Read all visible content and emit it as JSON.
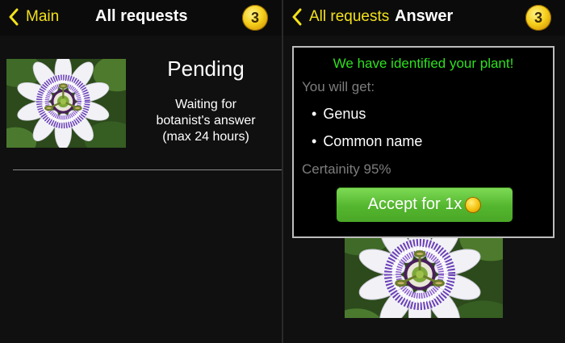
{
  "left_screen": {
    "nav": {
      "back_label": "Main",
      "title": "All requests",
      "coin_count": "3"
    },
    "request": {
      "status": "Pending",
      "description_lines": [
        "Waiting for",
        "botanist's answer",
        "(max 24 hours)"
      ]
    }
  },
  "right_screen": {
    "nav": {
      "back_label": "All requests",
      "title": "Answer",
      "coin_count": "3"
    },
    "card": {
      "headline": "We have identified your plant!",
      "you_will_get": "You will get:",
      "items": [
        "Genus",
        "Common name"
      ],
      "certainty": "Certainity 95%",
      "accept_label": "Accept for 1x"
    }
  },
  "colors": {
    "accent_yellow": "#f3e11a",
    "headline_green": "#2ee11f",
    "button_green": "#5cbf35"
  },
  "icons": {
    "back": "chevron-left-icon",
    "coin": "gold-coin-icon",
    "photo": "passion-flower-photo"
  }
}
